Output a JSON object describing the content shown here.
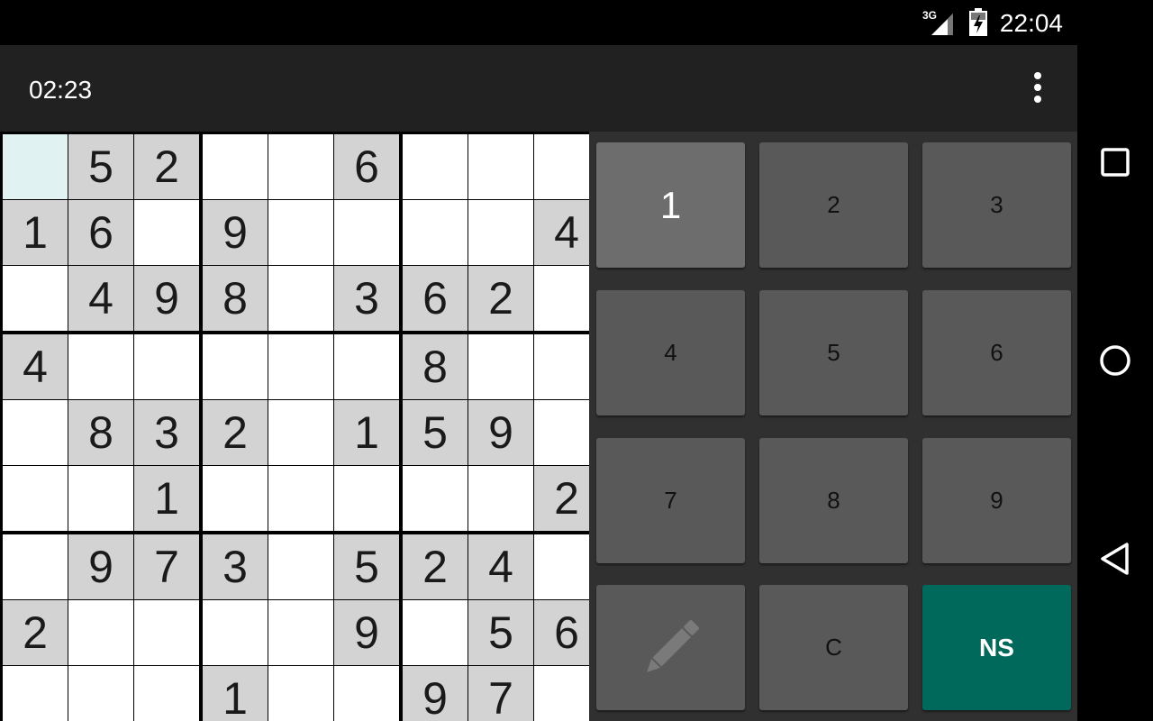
{
  "status_bar": {
    "network": "3G",
    "time": "22:04"
  },
  "app_bar": {
    "timer": "02:23",
    "menu_icon": "more-vert-icon"
  },
  "board": {
    "selected_cell": [
      0,
      0
    ],
    "rows": [
      [
        "",
        "5",
        "2",
        "",
        "",
        "6",
        "",
        "",
        ""
      ],
      [
        "1",
        "6",
        "",
        "9",
        "",
        "",
        "",
        "",
        "4"
      ],
      [
        "",
        "4",
        "9",
        "8",
        "",
        "3",
        "6",
        "2",
        ""
      ],
      [
        "4",
        "",
        "",
        "",
        "",
        "",
        "8",
        "",
        ""
      ],
      [
        "",
        "8",
        "3",
        "2",
        "",
        "1",
        "5",
        "9",
        ""
      ],
      [
        "",
        "",
        "1",
        "",
        "",
        "",
        "",
        "",
        "2"
      ],
      [
        "",
        "9",
        "7",
        "3",
        "",
        "5",
        "2",
        "4",
        ""
      ],
      [
        "2",
        "",
        "",
        "",
        "",
        "9",
        "",
        "5",
        "6"
      ],
      [
        "",
        "",
        "",
        "1",
        "",
        "",
        "9",
        "7",
        ""
      ]
    ]
  },
  "keypad": {
    "keys": [
      "1",
      "2",
      "3",
      "4",
      "5",
      "6",
      "7",
      "8",
      "9"
    ],
    "active_key": "1",
    "pencil_icon": "pencil-icon",
    "clear_label": "C",
    "ns_label": "NS"
  },
  "nav_bar": {
    "recents_icon": "recents-square-icon",
    "home_icon": "home-circle-icon",
    "back_icon": "back-triangle-icon"
  },
  "colors": {
    "given_cell": "#d3d3d3",
    "empty_cell": "#ffffff",
    "selected_cell": "#e0f2f1",
    "key": "#595959",
    "active_key": "#6d6d6d",
    "ns_key": "#00695c",
    "app_bar": "#212121"
  }
}
